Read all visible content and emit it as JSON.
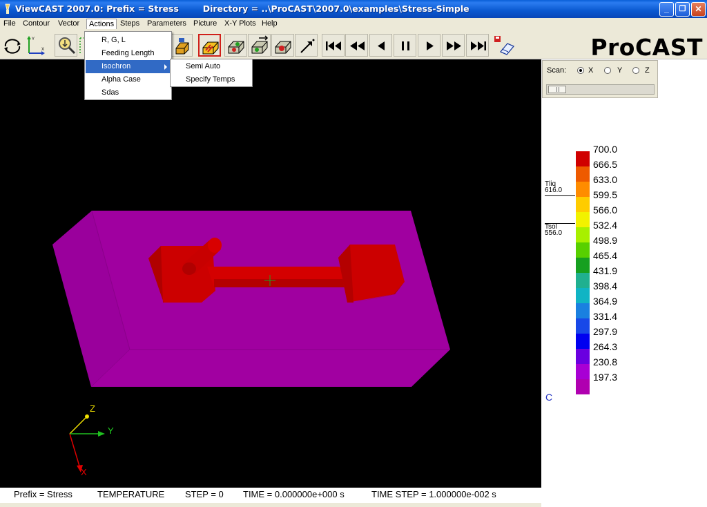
{
  "window": {
    "title": "ViewCAST 2007.0: Prefix = Stress        Directory = ..\\ProCAST\\2007.0\\examples\\Stress-Simple",
    "minimize_glyph": "_",
    "maximize_glyph": "❐",
    "close_glyph": "✕"
  },
  "menubar": {
    "items": [
      "File",
      "Contour",
      "Vector",
      "Actions",
      "Steps",
      "Parameters",
      "Picture",
      "X-Y Plots",
      "Help"
    ]
  },
  "actions_menu": {
    "items": [
      "R, G, L",
      "Feeding Length",
      "Isochron",
      "Alpha Case",
      "Sdas"
    ],
    "selected": "Isochron"
  },
  "isochron_submenu": {
    "items": [
      "Semi Auto",
      "Specify Temps"
    ]
  },
  "toolbar": {
    "logo": "ProCAST",
    "icons": [
      "rotate-icon",
      "axes-icon",
      "zoom-icon",
      "clip-icon",
      "part-shaded-icon",
      "part-surface-icon",
      "part-vector-icon",
      "part-cut-icon",
      "part-arrow-icon",
      "pick-arrow-icon",
      "first-step-icon",
      "rewind-icon",
      "step-back-icon",
      "pause-icon",
      "play-icon",
      "fast-forward-icon",
      "last-step-icon",
      "save-eraser-icon"
    ]
  },
  "scan": {
    "label": "Scan:",
    "options": [
      "X",
      "Y",
      "Z"
    ],
    "selected": "X",
    "slider_value": 0.02
  },
  "legend": {
    "levels": [
      "700.0",
      "666.5",
      "633.0",
      "599.5",
      "566.0",
      "532.4",
      "498.9",
      "465.4",
      "431.9",
      "398.4",
      "364.9",
      "331.4",
      "297.9",
      "264.3",
      "230.8",
      "197.3"
    ],
    "colors": [
      "#d00000",
      "#ee5a00",
      "#ff8c00",
      "#ffcc00",
      "#f2f200",
      "#a8f000",
      "#58d000",
      "#16a020",
      "#20b090",
      "#10b4c4",
      "#1a80e0",
      "#1848e8",
      "#0000f0",
      "#6a00e0",
      "#a800d4",
      "#b000b0"
    ],
    "tliq_label": "Tliq",
    "tliq_value": "616.0",
    "tsol_label": "Tsol",
    "tsol_value": "556.0",
    "unit": "C"
  },
  "axes": {
    "x": "X",
    "y": "Y",
    "z": "Z"
  },
  "status": {
    "prefix": "Prefix = Stress",
    "field": "TEMPERATURE",
    "step": "STEP = 0",
    "time": "TIME = 0.000000e+000 s",
    "time_step": "TIME STEP = 1.000000e-002 s"
  }
}
